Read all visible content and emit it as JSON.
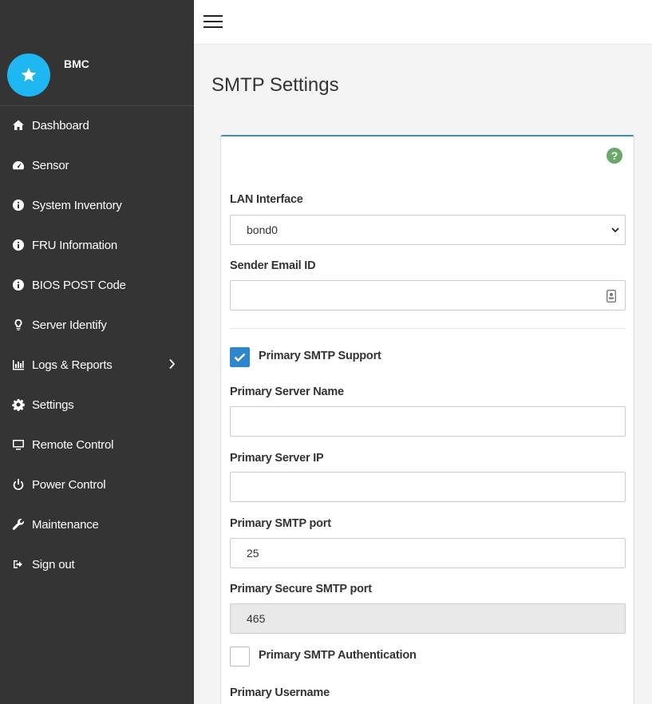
{
  "brand": {
    "name": "BMC"
  },
  "sidebar": {
    "items": [
      {
        "label": "Dashboard",
        "icon": "home-icon"
      },
      {
        "label": "Sensor",
        "icon": "gauge-icon"
      },
      {
        "label": "System Inventory",
        "icon": "info-icon"
      },
      {
        "label": "FRU Information",
        "icon": "info-icon"
      },
      {
        "label": "BIOS POST Code",
        "icon": "info-icon"
      },
      {
        "label": "Server Identify",
        "icon": "lightbulb-icon"
      },
      {
        "label": "Logs & Reports",
        "icon": "bar-chart-icon"
      },
      {
        "label": "Settings",
        "icon": "gear-icon"
      },
      {
        "label": "Remote Control",
        "icon": "monitor-icon"
      },
      {
        "label": "Power Control",
        "icon": "power-icon"
      },
      {
        "label": "Maintenance",
        "icon": "wrench-icon"
      },
      {
        "label": "Sign out",
        "icon": "sign-out-icon"
      }
    ]
  },
  "page": {
    "title": "SMTP Settings"
  },
  "form": {
    "lan_interface": {
      "label": "LAN Interface",
      "value": "bond0"
    },
    "sender_email": {
      "label": "Sender Email ID",
      "value": ""
    },
    "primary_smtp_support": {
      "label": "Primary SMTP Support",
      "checked": true
    },
    "primary_server_name": {
      "label": "Primary Server Name",
      "value": ""
    },
    "primary_server_ip": {
      "label": "Primary Server IP",
      "value": ""
    },
    "primary_smtp_port": {
      "label": "Primary SMTP port",
      "value": "25"
    },
    "primary_secure_smtp_port": {
      "label": "Primary Secure SMTP port",
      "value": "465"
    },
    "primary_smtp_auth": {
      "label": "Primary SMTP Authentication",
      "checked": false
    },
    "primary_username": {
      "label": "Primary Username"
    }
  },
  "colors": {
    "sidebar_bg": "#343434",
    "brand_accent": "#1fb7f2",
    "checkbox_on": "#2f86cc",
    "help_icon": "#6aa86a",
    "card_border_top": "#3a8fc6"
  }
}
